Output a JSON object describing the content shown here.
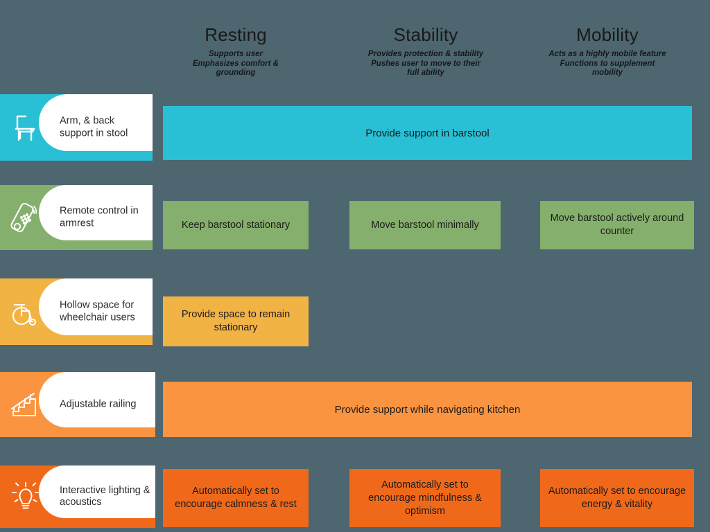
{
  "colors": {
    "background": "#4d6670",
    "teal": "#29bfd4",
    "green": "#85af6c",
    "amber": "#f2b345",
    "orange_light": "#fa9441",
    "orange_dark": "#f0691b",
    "card_white": "#ffffff",
    "text_dark": "#1b1b1b"
  },
  "columns": [
    {
      "id": "resting",
      "title": "Resting",
      "subtitle": "Supports user\nEmphasizes comfort &\ngrounding"
    },
    {
      "id": "stability",
      "title": "Stability",
      "subtitle": "Provides protection & stability\nPushes user to move to their\nfull ability"
    },
    {
      "id": "mobility",
      "title": "Mobility",
      "subtitle": "Acts as a highly mobile feature\nFunctions to supplement\nmobility"
    }
  ],
  "rows": [
    {
      "id": "arm-back-support",
      "label": "Arm, & back support in stool",
      "icon": "chair-icon",
      "color": "#29bfd4",
      "bars": [
        {
          "span": "all",
          "text": "Provide support in barstool"
        }
      ]
    },
    {
      "id": "remote-control",
      "label": "Remote control in armrest",
      "icon": "remote-control-icon",
      "color": "#85af6c",
      "bars": [
        {
          "span": "resting",
          "text": "Keep barstool stationary"
        },
        {
          "span": "stability",
          "text": "Move barstool minimally"
        },
        {
          "span": "mobility",
          "text": "Move barstool actively around counter"
        }
      ]
    },
    {
      "id": "hollow-space",
      "label": "Hollow space for wheelchair users",
      "icon": "wheelchair-icon",
      "color": "#f2b345",
      "bars": [
        {
          "span": "resting",
          "text": "Provide space to remain stationary"
        }
      ]
    },
    {
      "id": "adjustable-railing",
      "label": "Adjustable railing",
      "icon": "stairs-railing-icon",
      "color": "#fa9441",
      "bars": [
        {
          "span": "all",
          "text": "Provide support while navigating kitchen"
        }
      ]
    },
    {
      "id": "interactive-lighting",
      "label": "Interactive lighting & acoustics",
      "icon": "lightbulb-icon",
      "color": "#f0691b",
      "bars": [
        {
          "span": "resting",
          "text": "Automatically set to encourage calmness & rest"
        },
        {
          "span": "stability",
          "text": "Automatically set to encourage mindfulness & optimism"
        },
        {
          "span": "mobility",
          "text": "Automatically set to encourage energy & vitality"
        }
      ]
    }
  ]
}
